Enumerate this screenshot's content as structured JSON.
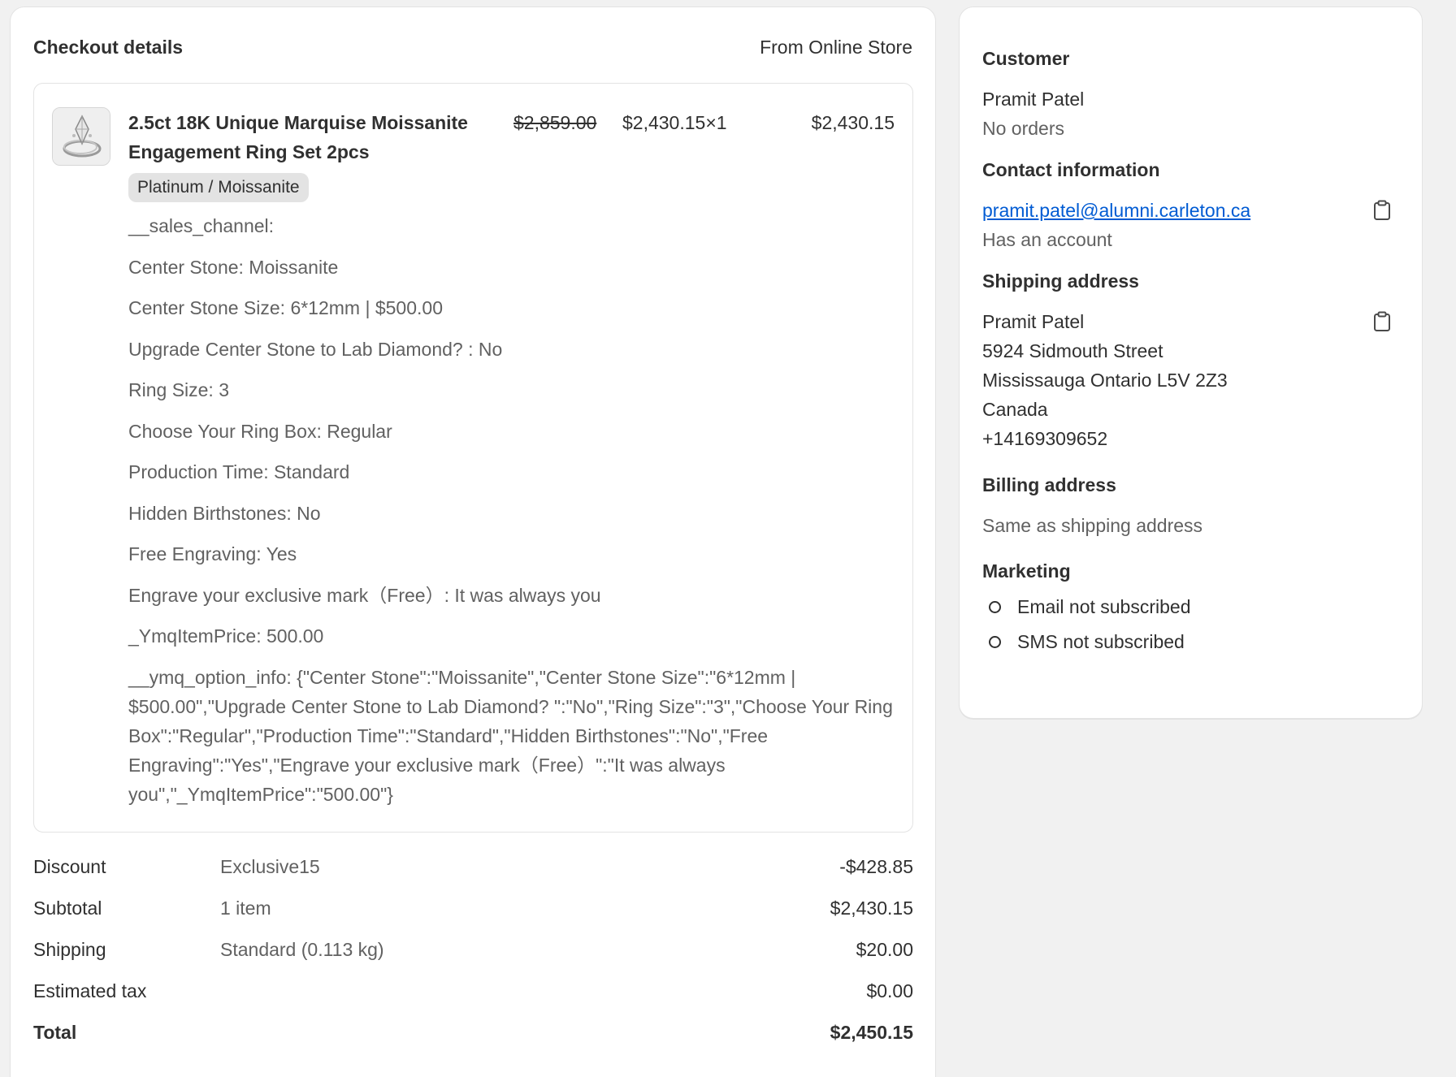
{
  "checkout": {
    "title": "Checkout details",
    "source": "From Online Store"
  },
  "line_item": {
    "thumbnail_icon": "ring-thumbnail",
    "title": "2.5ct 18K Unique Marquise Moissanite Engagement Ring Set 2pcs",
    "original_price": "$2,859.00",
    "unit_price_qty": "$2,430.15×1",
    "line_total": "$2,430.15",
    "variant": "Platinum / Moissanite",
    "properties": [
      "__sales_channel:",
      "Center Stone: Moissanite",
      "Center Stone Size: 6*12mm | $500.00",
      "Upgrade Center Stone to Lab Diamond? : No",
      "Ring Size: 3",
      "Choose Your Ring Box: Regular",
      "Production Time: Standard",
      "Hidden Birthstones: No",
      "Free Engraving: Yes",
      "Engrave your exclusive mark（Free）: It was always you",
      "_YmqItemPrice: 500.00",
      "__ymq_option_info: {\"Center Stone\":\"Moissanite\",\"Center Stone Size\":\"6*12mm | $500.00\",\"Upgrade Center Stone to Lab Diamond? \":\"No\",\"Ring Size\":\"3\",\"Choose Your Ring Box\":\"Regular\",\"Production Time\":\"Standard\",\"Hidden Birthstones\":\"No\",\"Free Engraving\":\"Yes\",\"Engrave your exclusive mark（Free）\":\"It was always you\",\"_YmqItemPrice\":\"500.00\"}"
    ]
  },
  "summary": {
    "discount": {
      "label": "Discount",
      "detail": "Exclusive15",
      "amount": "-$428.85"
    },
    "subtotal": {
      "label": "Subtotal",
      "detail": "1 item",
      "amount": "$2,430.15"
    },
    "shipping": {
      "label": "Shipping",
      "detail": "Standard (0.113 kg)",
      "amount": "$20.00"
    },
    "tax": {
      "label": "Estimated tax",
      "detail": "",
      "amount": "$0.00"
    },
    "total": {
      "label": "Total",
      "detail": "",
      "amount": "$2,450.15"
    }
  },
  "customer": {
    "heading": "Customer",
    "name": "Pramit Patel",
    "orders": "No orders"
  },
  "contact": {
    "heading": "Contact information",
    "email": "pramit.patel@alumni.carleton.ca",
    "account": "Has an account",
    "copy_icon": "clipboard-icon"
  },
  "shipping_address": {
    "heading": "Shipping address",
    "lines": [
      "Pramit Patel",
      "5924 Sidmouth Street",
      "Mississauga Ontario L5V 2Z3",
      "Canada",
      "+14169309652"
    ],
    "copy_icon": "clipboard-icon"
  },
  "billing_address": {
    "heading": "Billing address",
    "text": "Same as shipping address"
  },
  "marketing": {
    "heading": "Marketing",
    "email_status": "Email not subscribed",
    "sms_status": "SMS not subscribed"
  },
  "colors": {
    "background": "#f1f1f1",
    "card": "#ffffff",
    "text": "#303030",
    "muted": "#616161",
    "link": "#005bd3",
    "badge": "#e3e3e3"
  }
}
